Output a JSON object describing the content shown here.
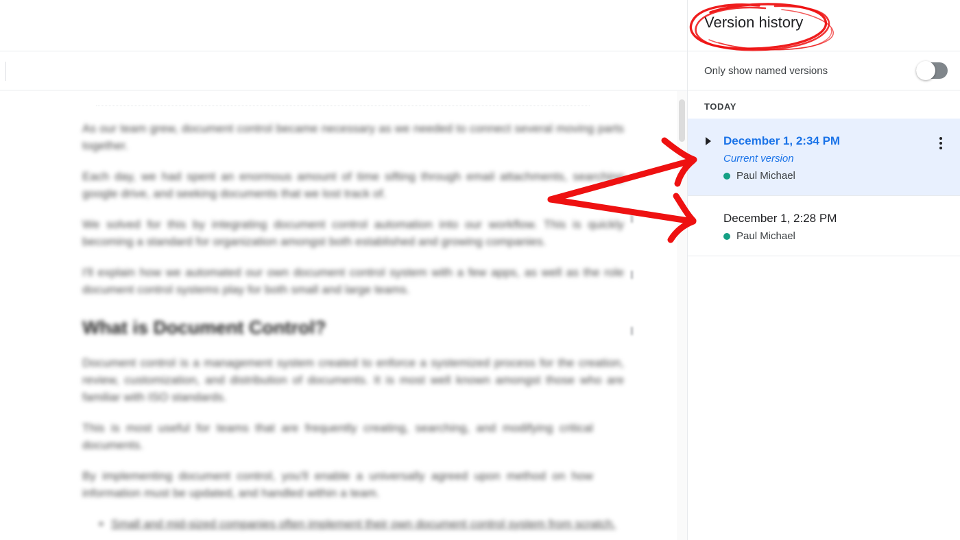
{
  "document": {
    "paragraphs": [
      "As our team grew, document control became necessary as we needed to connect several moving parts together.",
      "Each day, we had spent an enormous amount of time sifting through email attachments, searching google drive, and seeking documents that we lost track of.",
      "We solved for this by integrating document control automation into our workflow. This is quickly becoming a standard for organization amongst both established and growing companies.",
      "I'll explain how we automated our own document control system with a few apps, as well as the role document control systems play for both small and large teams."
    ],
    "heading": "What is Document Control?",
    "paragraphs_after": [
      "Document control is a management system created to enforce a systemized process for the creation, review, customization, and distribution of documents. It is most well known amongst those who are familiar with ISO standards.",
      "This is most useful for teams that are frequently creating, searching, and modifying critical documents.",
      "By implementing document control, you'll enable a universally agreed upon method on how information must be updated, and handled within a team."
    ],
    "bullets": [
      "Small and mid-sized companies often implement their own document control system from scratch."
    ]
  },
  "panel": {
    "title": "Version history",
    "named_versions_label": "Only show named versions",
    "named_versions_toggle_state": "off",
    "group_label": "TODAY",
    "versions": [
      {
        "date": "December 1, 2:34 PM",
        "sub": "Current version",
        "author": "Paul Michael",
        "selected": true,
        "has_expand_arrow": true,
        "has_kebab": true
      },
      {
        "date": "December 1, 2:28 PM",
        "sub": "",
        "author": "Paul Michael",
        "selected": false,
        "has_expand_arrow": false,
        "has_kebab": false
      }
    ]
  },
  "icons": {
    "expand_arrow": "triangle-right-icon",
    "kebab": "more-vertical-icon",
    "author_dot": "presence-dot-icon",
    "toggle": "switch-icon"
  },
  "annotations": {
    "circle_target": "Version history",
    "arrow_targets": [
      "December 1, 2:34 PM",
      "December 1, 2:28 PM"
    ],
    "color": "#ee1111"
  },
  "colors": {
    "accent_blue": "#1a73e8",
    "selected_row_bg": "#e8f0fe",
    "author_green": "#15a085",
    "annotation_red": "#ee1111",
    "divider": "#e8eaed"
  }
}
